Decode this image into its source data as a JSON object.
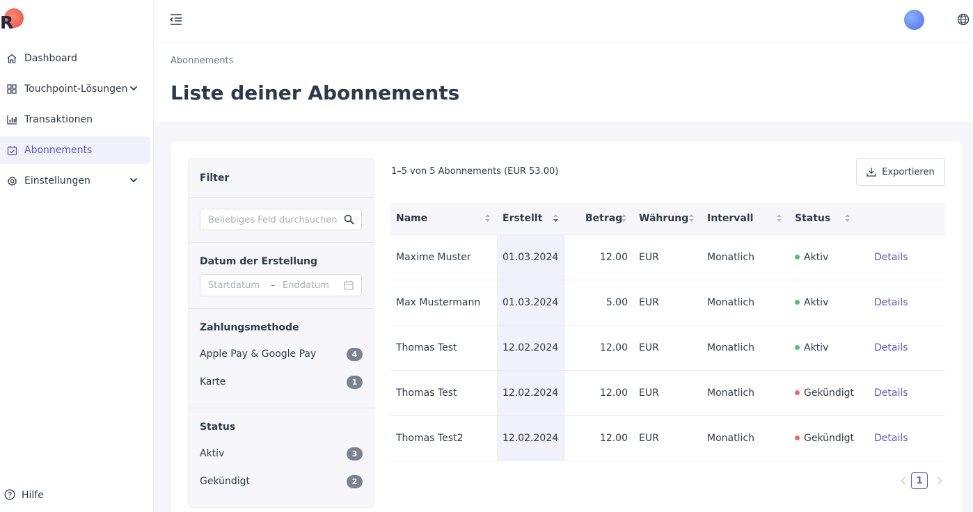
{
  "colors": {
    "accent": "#5b57d1",
    "active": "#4fbf7a",
    "cancelled": "#ef6a5a",
    "badge": "#7d8290"
  },
  "sidebar": {
    "logo_letter": "R",
    "items": [
      {
        "label": "Dashboard",
        "icon": "home-icon"
      },
      {
        "label": "Touchpoint-Lösungen",
        "icon": "grid-icon",
        "expandable": true
      },
      {
        "label": "Transaktionen",
        "icon": "bar-chart-icon"
      },
      {
        "label": "Abonnements",
        "icon": "calendar-check-icon",
        "active": true
      },
      {
        "label": "Einstellungen",
        "icon": "gear-icon",
        "expandable": true
      }
    ],
    "help_label": "Hilfe"
  },
  "topbar": {
    "menu_icon": "menu-collapse-icon",
    "avatar": "avatar",
    "language_icon": "globe-icon"
  },
  "header": {
    "breadcrumb": "Abonnements",
    "title": "Liste deiner Abonnements"
  },
  "filter": {
    "title": "Filter",
    "search_placeholder": "Beliebiges Feld durchsuchen",
    "date_section": "Datum der Erstellung",
    "date_start_placeholder": "Startdatum",
    "date_separator": "–",
    "date_end_placeholder": "Enddatum",
    "payment_section": "Zahlungsmethode",
    "payment_options": [
      {
        "label": "Apple Pay & Google Pay",
        "count": "4"
      },
      {
        "label": "Karte",
        "count": "1"
      }
    ],
    "status_section": "Status",
    "status_options": [
      {
        "label": "Aktiv",
        "count": "3"
      },
      {
        "label": "Gekündigt",
        "count": "2"
      }
    ]
  },
  "summary": "1–5 von 5 Abonnements (EUR 53.00)",
  "export_label": "Exportieren",
  "table": {
    "columns": [
      "Name",
      "Erstellt",
      "Betrag",
      "Währung",
      "Intervall",
      "Status"
    ],
    "sorted_column": "Erstellt",
    "sort_direction": "descending",
    "rows": [
      {
        "name": "Maxime Muster",
        "created": "01.03.2024",
        "amount": "12.00",
        "currency": "EUR",
        "interval": "Monatlich",
        "status": "Aktiv",
        "status_type": "active",
        "action": "Details"
      },
      {
        "name": "Max Mustermann",
        "created": "01.03.2024",
        "amount": "5.00",
        "currency": "EUR",
        "interval": "Monatlich",
        "status": "Aktiv",
        "status_type": "active",
        "action": "Details"
      },
      {
        "name": "Thomas Test",
        "created": "12.02.2024",
        "amount": "12.00",
        "currency": "EUR",
        "interval": "Monatlich",
        "status": "Aktiv",
        "status_type": "active",
        "action": "Details"
      },
      {
        "name": "Thomas Test",
        "created": "12.02.2024",
        "amount": "12.00",
        "currency": "EUR",
        "interval": "Monatlich",
        "status": "Gekündigt",
        "status_type": "cancelled",
        "action": "Details"
      },
      {
        "name": "Thomas Test2",
        "created": "12.02.2024",
        "amount": "12.00",
        "currency": "EUR",
        "interval": "Monatlich",
        "status": "Gekündigt",
        "status_type": "cancelled",
        "action": "Details"
      }
    ]
  },
  "pagination": {
    "current_page": "1"
  }
}
